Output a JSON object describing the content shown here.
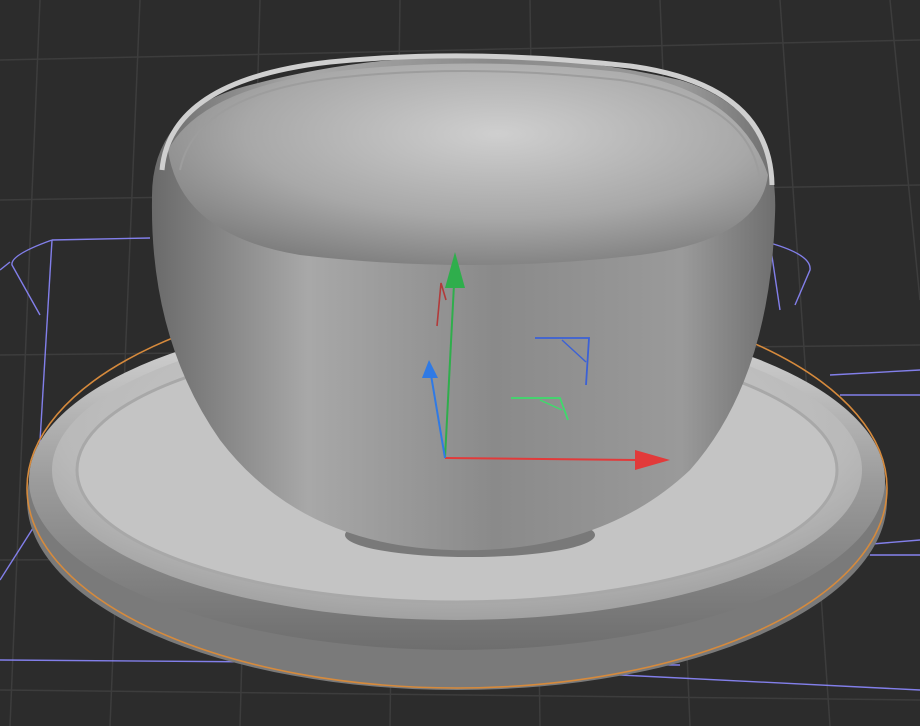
{
  "viewport": {
    "view": "perspective",
    "background": "#2c2c2c",
    "grid_color": "#3c3c3c"
  },
  "scene": {
    "objects": [
      {
        "name": "cup",
        "selected": false
      },
      {
        "name": "saucer",
        "selected": true
      }
    ],
    "selection_outline_color": "#d68a3c",
    "bounding_box_color": "#8c88ff"
  },
  "gizmo": {
    "mode": "move",
    "x_axis_color": "#e23a3a",
    "y_axis_color": "#2fae4c",
    "z_axis_color": "#2f7ae5",
    "plane_xy_color": "#3b61d6",
    "plane_xz_color": "#3ddc6b",
    "icons": [
      "arrow-x-icon",
      "arrow-y-icon",
      "arrow-z-icon",
      "plane-xy-handle-icon",
      "plane-xz-handle-icon",
      "rotation-arc-icon"
    ]
  }
}
